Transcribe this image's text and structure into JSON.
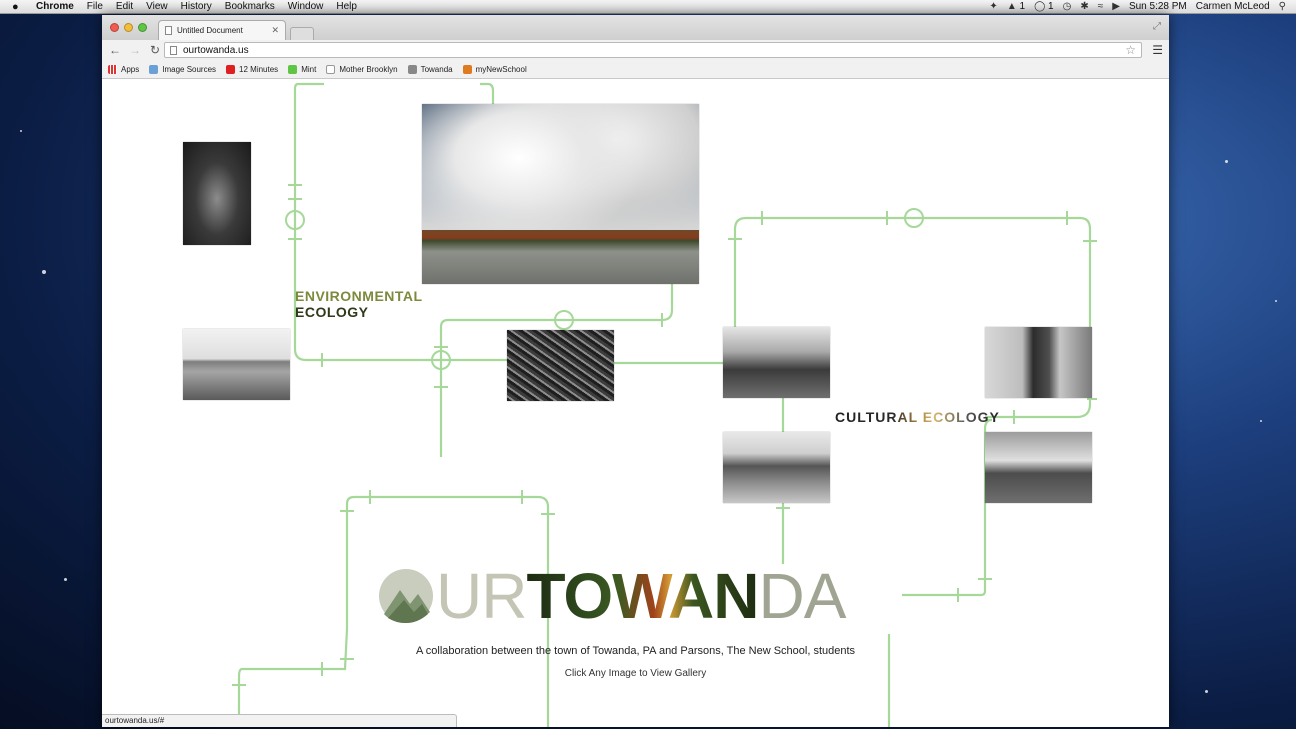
{
  "menubar": {
    "app_name": "Chrome",
    "items": [
      "File",
      "Edit",
      "View",
      "History",
      "Bookmarks",
      "Window",
      "Help"
    ],
    "status_a": "1",
    "status_b": "1",
    "clock": "Sun 5:28 PM",
    "user": "Carmen McLeod"
  },
  "browser": {
    "tab_title": "Untitled Document",
    "url": "ourtowanda.us",
    "bookmarks": [
      "Apps",
      "Image Sources",
      "12 Minutes",
      "Mint",
      "Mother Brooklyn",
      "Towanda",
      "myNewSchool"
    ],
    "status_url": "ourtowanda.us/#"
  },
  "page": {
    "env_label_line1": "ENVIRONMENTAL",
    "env_label_line2": "ECOLOGY",
    "cultural_label": "CULTURAL ECOLOGY",
    "logo": {
      "part1": "UR ",
      "part2": "TOWAN",
      "part3": "DA"
    },
    "tagline": "A collaboration between the town of Towanda, PA and Parsons, The New School, students",
    "cta": "Click Any Image to View Gallery"
  },
  "colors": {
    "pipe": "#a6d89a",
    "accent_green": "#7c8a3c"
  }
}
